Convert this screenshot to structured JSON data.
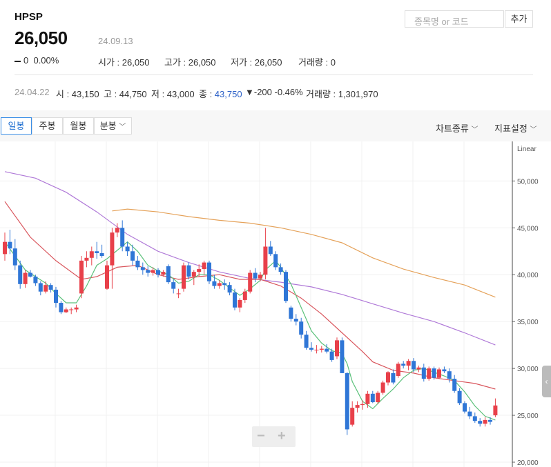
{
  "header": {
    "symbol": "HPSP",
    "price": "26,050",
    "date": "24.09.13",
    "change": "0",
    "change_pct": "0.00%",
    "open_label": "시가 : 26,050",
    "high_label": "고가 : 26,050",
    "low_label": "저가 : 26,050",
    "volume_label": "거래량 : 0"
  },
  "search": {
    "placeholder": "종목명 or 코드",
    "add_label": "추가"
  },
  "history": {
    "date": "24.04.22",
    "open": "시 : 43,150",
    "high": "고 : 44,750",
    "low": "저 : 43,000",
    "close_label": "종 : ",
    "close": "43,750",
    "change": "▼-200",
    "change_pct": "-0.46%",
    "volume": "거래량 : 1,301,970"
  },
  "tabs": [
    "일봉",
    "주봉",
    "월봉",
    "분봉"
  ],
  "active_tab": "일봉",
  "menus": {
    "chart_type": "차트종류",
    "indicator": "지표설정"
  },
  "zoom": {
    "minus": "−",
    "plus": "+"
  },
  "colors": {
    "up": "#e8404a",
    "down": "#2f76d6",
    "ma5": "#5bc17a",
    "ma20": "#d9565d",
    "ma60": "#b07ad8",
    "ma120": "#e5a25a"
  },
  "chart_data": {
    "type": "candlestick",
    "y_scale_label": "Linear",
    "ylim": [
      20000,
      54000
    ],
    "y_ticks": [
      "50,000",
      "45,000",
      "40,000",
      "35,000",
      "30,000",
      "25,000",
      "20,000"
    ],
    "y_tick_values": [
      50000,
      45000,
      40000,
      35000,
      30000,
      25000,
      20000
    ],
    "candles": [
      [
        42200,
        44500,
        41500,
        43500
      ],
      [
        43500,
        44800,
        42200,
        42800
      ],
      [
        42800,
        43800,
        40500,
        41000
      ],
      [
        41000,
        41500,
        38500,
        39000
      ],
      [
        39000,
        40500,
        38600,
        40200
      ],
      [
        40200,
        40500,
        39700,
        39800
      ],
      [
        39800,
        40000,
        38800,
        39100
      ],
      [
        39100,
        39300,
        37800,
        38200
      ],
      [
        38200,
        39300,
        38000,
        38900
      ],
      [
        38900,
        39100,
        38100,
        38400
      ],
      [
        38400,
        38700,
        36500,
        37000
      ],
      [
        37000,
        37200,
        35800,
        36000
      ],
      [
        36000,
        36500,
        35900,
        36300
      ],
      [
        36300,
        36500,
        35800,
        36300
      ],
      [
        36300,
        36800,
        36000,
        36500
      ],
      [
        38000,
        42000,
        37500,
        41500
      ],
      [
        41500,
        42500,
        40800,
        41800
      ],
      [
        41800,
        43000,
        41000,
        42500
      ],
      [
        42500,
        43500,
        41700,
        42300
      ],
      [
        42300,
        43200,
        41800,
        42000
      ],
      [
        38500,
        41500,
        38400,
        41000
      ],
      [
        41000,
        45000,
        38500,
        44500
      ],
      [
        44500,
        45500,
        44000,
        45000
      ],
      [
        45000,
        45800,
        42500,
        43000
      ],
      [
        43000,
        43500,
        42000,
        42500
      ],
      [
        42500,
        43200,
        41000,
        41500
      ],
      [
        41500,
        42000,
        40500,
        40800
      ],
      [
        40800,
        41300,
        40000,
        40500
      ],
      [
        40500,
        40900,
        39800,
        40200
      ],
      [
        40200,
        40800,
        39900,
        40500
      ],
      [
        40500,
        40700,
        39700,
        40000
      ],
      [
        40000,
        40500,
        39800,
        40300
      ],
      [
        40900,
        41100,
        39000,
        39200
      ],
      [
        39200,
        39500,
        38000,
        38500
      ],
      [
        38000,
        38500,
        37500,
        38000
      ],
      [
        38500,
        41300,
        38200,
        41000
      ],
      [
        41000,
        41300,
        39500,
        39800
      ],
      [
        39800,
        40500,
        38900,
        40300
      ],
      [
        40300,
        41100,
        39800,
        40600
      ],
      [
        40600,
        41500,
        40000,
        41300
      ],
      [
        41300,
        41500,
        39000,
        39300
      ],
      [
        39300,
        40000,
        38500,
        38800
      ],
      [
        38800,
        39400,
        38500,
        39100
      ],
      [
        39100,
        39500,
        38400,
        38900
      ],
      [
        38900,
        39200,
        37800,
        38100
      ],
      [
        38100,
        38500,
        36200,
        36500
      ],
      [
        36500,
        37500,
        36000,
        37300
      ],
      [
        37300,
        38500,
        37000,
        38200
      ],
      [
        38200,
        40500,
        38000,
        40200
      ],
      [
        40200,
        40700,
        39200,
        39600
      ],
      [
        39600,
        40300,
        39300,
        40000
      ],
      [
        40000,
        45000,
        39500,
        43000
      ],
      [
        43000,
        43600,
        42000,
        42200
      ],
      [
        42200,
        42500,
        40500,
        40800
      ],
      [
        40800,
        41200,
        40000,
        40300
      ],
      [
        40300,
        40500,
        37000,
        37200
      ],
      [
        36500,
        36700,
        35000,
        35300
      ],
      [
        35300,
        35800,
        34600,
        35000
      ],
      [
        35000,
        35400,
        33200,
        33600
      ],
      [
        33600,
        34000,
        32000,
        32200
      ],
      [
        32200,
        32800,
        31800,
        32000
      ],
      [
        32000,
        32500,
        31600,
        32000
      ],
      [
        32000,
        32400,
        31700,
        32100
      ],
      [
        32100,
        32600,
        31600,
        31800
      ],
      [
        31800,
        32100,
        30700,
        30900
      ],
      [
        31300,
        33300,
        31000,
        33000
      ],
      [
        33000,
        33300,
        29500,
        29500
      ],
      [
        29500,
        29600,
        22900,
        23500
      ],
      [
        24000,
        26500,
        23800,
        25800
      ],
      [
        25800,
        26500,
        25300,
        26100
      ],
      [
        26100,
        26600,
        25600,
        26200
      ],
      [
        26200,
        27600,
        25800,
        27300
      ],
      [
        27300,
        27600,
        26300,
        26400
      ],
      [
        26400,
        27600,
        26200,
        27400
      ],
      [
        27400,
        28700,
        27200,
        28500
      ],
      [
        28500,
        29700,
        28200,
        29600
      ],
      [
        29500,
        29900,
        28300,
        28500
      ],
      [
        29200,
        30700,
        29000,
        30500
      ],
      [
        30500,
        30800,
        30000,
        30300
      ],
      [
        30300,
        31000,
        29800,
        30800
      ],
      [
        30800,
        31100,
        29600,
        29900
      ],
      [
        29900,
        30300,
        29600,
        30100
      ],
      [
        30100,
        30500,
        28600,
        28900
      ],
      [
        28900,
        30200,
        28700,
        30000
      ],
      [
        30000,
        30200,
        28800,
        29000
      ],
      [
        29000,
        30100,
        28900,
        29900
      ],
      [
        29900,
        30200,
        29500,
        29700
      ],
      [
        29700,
        30000,
        28500,
        28900
      ],
      [
        28900,
        29300,
        27400,
        27600
      ],
      [
        27600,
        27900,
        26100,
        26300
      ],
      [
        26300,
        26500,
        25200,
        25400
      ],
      [
        25400,
        25900,
        24600,
        24900
      ],
      [
        24900,
        25300,
        24200,
        24400
      ],
      [
        24400,
        24700,
        23800,
        24100
      ],
      [
        24100,
        24800,
        23800,
        24500
      ],
      [
        24500,
        24800,
        24000,
        24300
      ],
      [
        25000,
        26800,
        24800,
        26050
      ]
    ],
    "ma5": [
      [
        0,
        43500
      ],
      [
        2,
        42000
      ],
      [
        4,
        40500
      ],
      [
        6,
        39800
      ],
      [
        8,
        39100
      ],
      [
        10,
        38000
      ],
      [
        12,
        37000
      ],
      [
        14,
        37000
      ],
      [
        16,
        38800
      ],
      [
        18,
        41000
      ],
      [
        20,
        41700
      ],
      [
        22,
        42600
      ],
      [
        24,
        43500
      ],
      [
        26,
        42500
      ],
      [
        28,
        41000
      ],
      [
        30,
        40400
      ],
      [
        32,
        40000
      ],
      [
        34,
        39100
      ],
      [
        36,
        39300
      ],
      [
        38,
        40000
      ],
      [
        40,
        40000
      ],
      [
        42,
        39400
      ],
      [
        44,
        38600
      ],
      [
        46,
        37800
      ],
      [
        48,
        38500
      ],
      [
        50,
        39400
      ],
      [
        51,
        40500
      ],
      [
        52,
        41000
      ],
      [
        53,
        41500
      ],
      [
        54,
        40800
      ],
      [
        56,
        39000
      ],
      [
        58,
        36500
      ],
      [
        60,
        34000
      ],
      [
        62,
        32700
      ],
      [
        64,
        31900
      ],
      [
        66,
        31600
      ],
      [
        67,
        30500
      ],
      [
        68,
        28600
      ],
      [
        70,
        26500
      ],
      [
        72,
        25700
      ],
      [
        74,
        26800
      ],
      [
        76,
        27800
      ],
      [
        78,
        29000
      ],
      [
        80,
        29800
      ],
      [
        82,
        30000
      ],
      [
        84,
        29600
      ],
      [
        86,
        29200
      ],
      [
        88,
        28700
      ],
      [
        90,
        27500
      ],
      [
        92,
        26000
      ],
      [
        94,
        24900
      ],
      [
        96,
        24500
      ]
    ],
    "ma20": [
      [
        0,
        47800
      ],
      [
        5,
        44000
      ],
      [
        10,
        41500
      ],
      [
        15,
        39500
      ],
      [
        18,
        39800
      ],
      [
        22,
        40800
      ],
      [
        26,
        41000
      ],
      [
        30,
        40000
      ],
      [
        34,
        39500
      ],
      [
        38,
        39800
      ],
      [
        42,
        40000
      ],
      [
        46,
        39500
      ],
      [
        50,
        39500
      ],
      [
        54,
        38800
      ],
      [
        58,
        37500
      ],
      [
        62,
        35800
      ],
      [
        66,
        33800
      ],
      [
        70,
        31800
      ],
      [
        72,
        30700
      ],
      [
        76,
        29800
      ],
      [
        80,
        29500
      ],
      [
        84,
        29000
      ],
      [
        88,
        28700
      ],
      [
        92,
        28400
      ],
      [
        96,
        27800
      ]
    ],
    "ma60": [
      [
        0,
        51000
      ],
      [
        6,
        50300
      ],
      [
        12,
        48800
      ],
      [
        18,
        46700
      ],
      [
        24,
        44300
      ],
      [
        30,
        42500
      ],
      [
        36,
        41300
      ],
      [
        42,
        40300
      ],
      [
        48,
        39600
      ],
      [
        54,
        39200
      ],
      [
        60,
        38700
      ],
      [
        66,
        37900
      ],
      [
        72,
        36900
      ],
      [
        78,
        35900
      ],
      [
        84,
        35000
      ],
      [
        90,
        33800
      ],
      [
        96,
        32500
      ]
    ],
    "ma120": [
      [
        21,
        46800
      ],
      [
        24,
        47000
      ],
      [
        30,
        46700
      ],
      [
        36,
        46200
      ],
      [
        42,
        45800
      ],
      [
        48,
        45500
      ],
      [
        54,
        45000
      ],
      [
        60,
        44300
      ],
      [
        66,
        43400
      ],
      [
        72,
        41800
      ],
      [
        78,
        40600
      ],
      [
        84,
        39700
      ],
      [
        90,
        38900
      ],
      [
        96,
        37600
      ]
    ]
  }
}
